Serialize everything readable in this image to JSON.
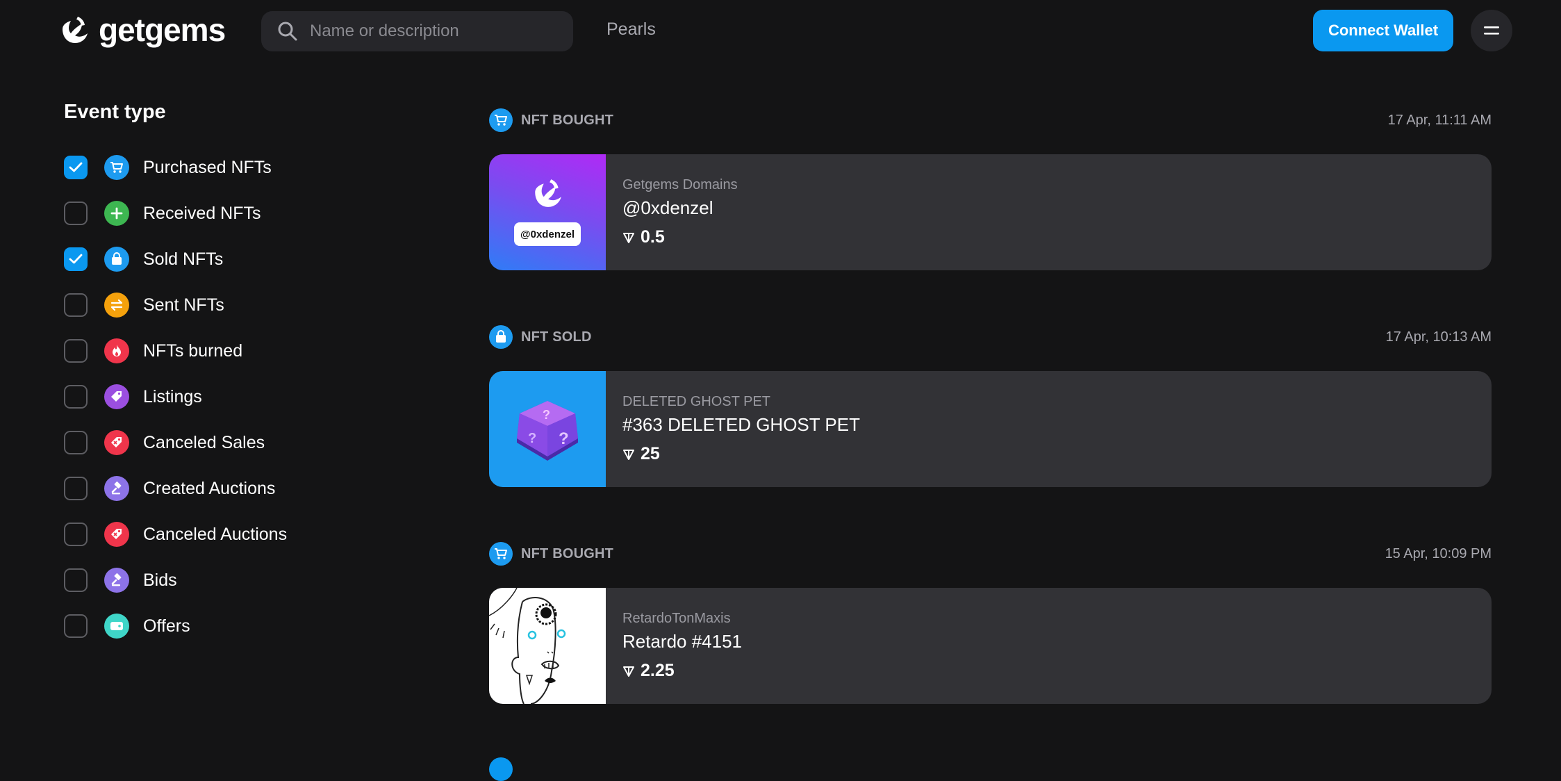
{
  "header": {
    "brand": "getgems",
    "search_placeholder": "Name or description",
    "nav_link": "Pearls",
    "connect_label": "Connect Wallet"
  },
  "sidebar": {
    "title": "Event type",
    "filters": [
      {
        "label": "Purchased NFTs",
        "checked": true,
        "icon": "cart-icon",
        "color": "#1d9bf0"
      },
      {
        "label": "Received NFTs",
        "checked": false,
        "icon": "plus-icon",
        "color": "#3db751"
      },
      {
        "label": "Sold NFTs",
        "checked": true,
        "icon": "bag-icon",
        "color": "#1d9bf0"
      },
      {
        "label": "Sent NFTs",
        "checked": false,
        "icon": "transfer-icon",
        "color": "#f5a10c"
      },
      {
        "label": "NFTs burned",
        "checked": false,
        "icon": "flame-icon",
        "color": "#f0354b"
      },
      {
        "label": "Listings",
        "checked": false,
        "icon": "tag-icon",
        "color": "#9b4fe0"
      },
      {
        "label": "Canceled Sales",
        "checked": false,
        "icon": "tag-cancel-icon",
        "color": "#f0354b"
      },
      {
        "label": "Created Auctions",
        "checked": false,
        "icon": "gavel-icon",
        "color": "#8d73e8"
      },
      {
        "label": "Canceled Auctions",
        "checked": false,
        "icon": "tag-cancel-icon",
        "color": "#f0354b"
      },
      {
        "label": "Bids",
        "checked": false,
        "icon": "gavel-icon",
        "color": "#8d73e8"
      },
      {
        "label": "Offers",
        "checked": false,
        "icon": "wallet-icon",
        "color": "#3fd6c8"
      }
    ]
  },
  "events": [
    {
      "type": "NFT BOUGHT",
      "time": "17 Apr, 11:11 AM",
      "collection": "Getgems Domains",
      "name": "@0xdenzel",
      "price": "0.5",
      "thumb_text": "@0xdenzel",
      "badge_icon": "cart-icon"
    },
    {
      "type": "NFT SOLD",
      "time": "17 Apr, 10:13 AM",
      "collection": "DELETED GHOST PET",
      "name": "#363 DELETED GHOST PET",
      "price": "25",
      "badge_icon": "bag-icon"
    },
    {
      "type": "NFT BOUGHT",
      "time": "15 Apr, 10:09 PM",
      "collection": "RetardoTonMaxis",
      "name": "Retardo #4151",
      "price": "2.25",
      "badge_icon": "cart-icon"
    }
  ],
  "colors": {
    "accent": "#0a98f0",
    "background": "#141415",
    "card": "#323236"
  }
}
